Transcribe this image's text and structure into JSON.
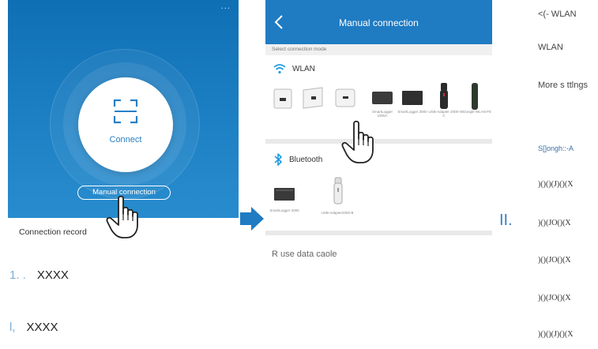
{
  "phone1": {
    "menu_dots": "···",
    "connect_label": "Connect",
    "manual_button": "Manual connection",
    "connection_record": "Connection record"
  },
  "phone2": {
    "title": "Manual connection",
    "subtitle": "Select connection mode",
    "wlan_label": "WLAN",
    "wlan_devices": [
      {
        "label": ""
      },
      {
        "label": ""
      },
      {
        "label": ""
      },
      {
        "label": "SmartLogger 1000A"
      },
      {
        "label": "SmartLogger 3000"
      },
      {
        "label": "USB-Adapter 2000-C"
      },
      {
        "label": "WDongle WLAN-FE"
      }
    ],
    "bluetooth_label": "Bluetooth",
    "bt_devices": [
      {
        "label": "SmartLogger 2000"
      },
      {
        "label": "USB-Adapter2000-B"
      }
    ],
    "usb_cable": "R   use data caole"
  },
  "right_column": {
    "line1": "<(-   WLAN",
    "line2": "WLAN",
    "line3": "More s  ttlngs",
    "line4": "S[]ongh::-A",
    "roman": "II.",
    "codes": [
      ")()()(J)()(X",
      ")()(JO()(X",
      ")()(JO()(X",
      ")()(JO()(X",
      ")()()(J)()(X"
    ]
  },
  "steps": [
    {
      "num": "1. .",
      "text": "XXXX"
    },
    {
      "num": "l,",
      "text": "XXXX"
    }
  ],
  "colors": {
    "brand_blue": "#1f7bc2",
    "accent_light_blue": "#7ab0dc"
  }
}
